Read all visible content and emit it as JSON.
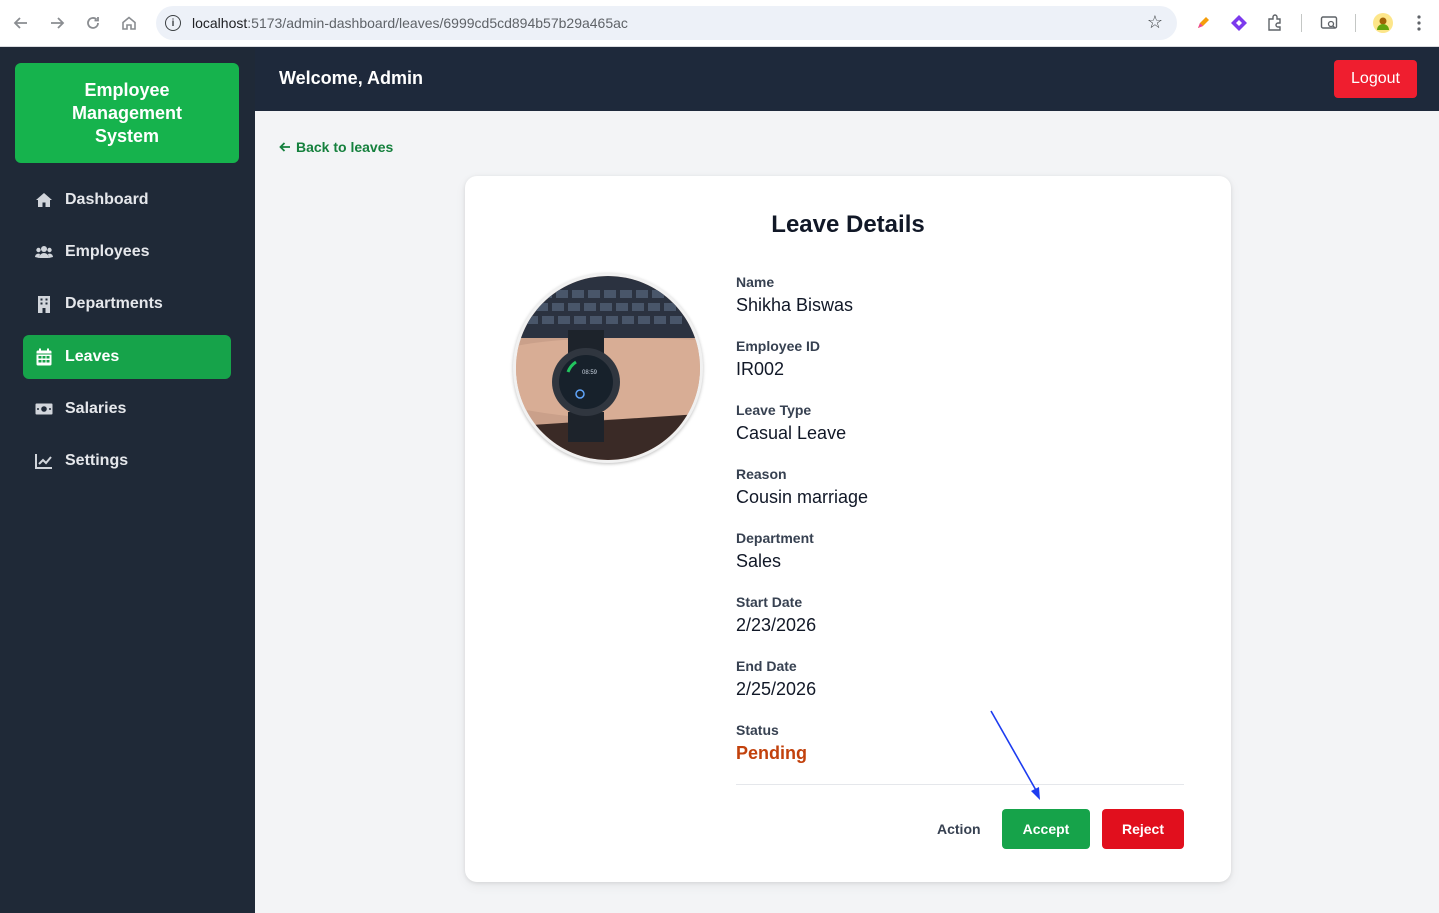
{
  "browser": {
    "url_host": "localhost",
    "url_path": ":5173/admin-dashboard/leaves/6999cd5cd894b57b29a465ac"
  },
  "sidebar": {
    "brand": "Employee Management System",
    "items": [
      {
        "label": "Dashboard",
        "icon": "home-icon"
      },
      {
        "label": "Employees",
        "icon": "users-icon"
      },
      {
        "label": "Departments",
        "icon": "building-icon"
      },
      {
        "label": "Leaves",
        "icon": "calendar-icon",
        "active": true
      },
      {
        "label": "Salaries",
        "icon": "money-icon"
      },
      {
        "label": "Settings",
        "icon": "chart-icon"
      }
    ]
  },
  "header": {
    "welcome": "Welcome, Admin",
    "logout_label": "Logout"
  },
  "main": {
    "back_label": "Back to leaves",
    "title": "Leave Details",
    "fields": [
      {
        "label": "Name",
        "value": "Shikha Biswas"
      },
      {
        "label": "Employee ID",
        "value": "IR002"
      },
      {
        "label": "Leave Type",
        "value": "Casual Leave"
      },
      {
        "label": "Reason",
        "value": "Cousin marriage"
      },
      {
        "label": "Department",
        "value": "Sales"
      },
      {
        "label": "Start Date",
        "value": "2/23/2026"
      },
      {
        "label": "End Date",
        "value": "2/25/2026"
      },
      {
        "label": "Status",
        "value": "Pending"
      }
    ],
    "action_label": "Action",
    "accept_label": "Accept",
    "reject_label": "Reject"
  },
  "colors": {
    "accent_green": "#16a34a",
    "danger_red": "#e10f1d",
    "sidebar_bg": "#1f2937",
    "header_bg": "#1e293b",
    "pending_orange": "#c2410c",
    "annotation_arrow": "#1d3cf0"
  }
}
